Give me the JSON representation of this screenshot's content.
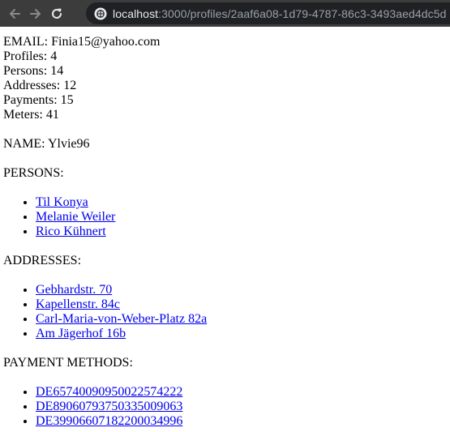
{
  "browser": {
    "url_host": "localhost",
    "url_path": ":3000/profiles/2aaf6a08-1d79-4787-86c3-3493aed4dc5d"
  },
  "stats": {
    "email_label": "EMAIL:",
    "email": "Finia15@yahoo.com",
    "profiles_label": "Profiles:",
    "profiles": "4",
    "persons_label": "Persons:",
    "persons": "14",
    "addresses_label": "Addresses:",
    "addresses": "12",
    "payments_label": "Payments:",
    "payments": "15",
    "meters_label": "Meters:",
    "meters": "41"
  },
  "name": {
    "label": "NAME:",
    "value": "Ylvie96"
  },
  "persons": {
    "heading": "PERSONS:",
    "items": [
      "Til Konya",
      "Melanie Weiler",
      "Rico Kühnert"
    ]
  },
  "addresses": {
    "heading": "ADDRESSES:",
    "items": [
      "Gebhardstr. 70",
      "Kapellenstr. 84c",
      "Carl-Maria-von-Weber-Platz 82a",
      "Am Jägerhof 16b"
    ]
  },
  "payment_methods": {
    "heading": "PAYMENT METHODS:",
    "items": [
      "DE65740090950022574222",
      "DE89060793750335009063",
      "DE39906607182200034996"
    ]
  }
}
